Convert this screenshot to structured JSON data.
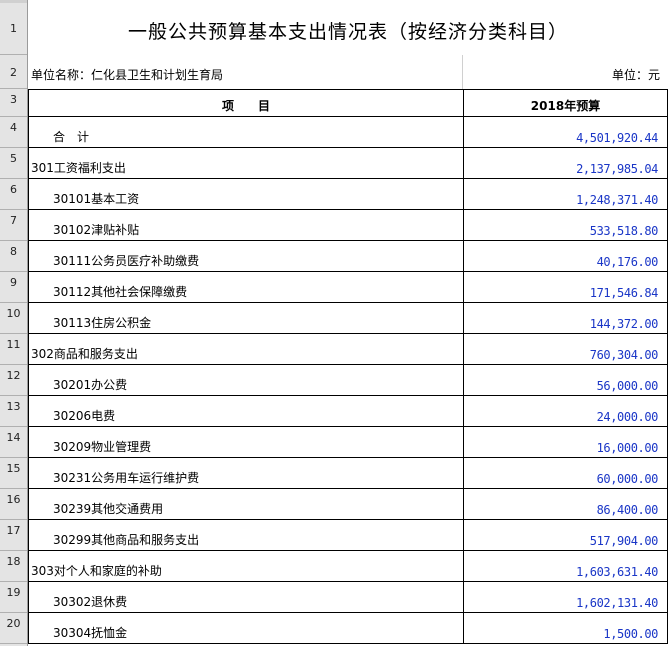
{
  "title": "一般公共预算基本支出情况表（按经济分类科目）",
  "unit_label": "单位名称：仁化县卫生和计划生育局",
  "unit": "单位：元",
  "row_headers": [
    "1",
    "2",
    "3",
    "4",
    "5",
    "6",
    "7",
    "8",
    "9",
    "10",
    "11",
    "12",
    "13",
    "14",
    "15",
    "16",
    "17",
    "18",
    "19",
    "20"
  ],
  "table": {
    "header_item": "项　　目",
    "header_budget": "2018年预算",
    "rows": [
      {
        "item": "合　计",
        "value": "4,501,920.44",
        "indent": 2
      },
      {
        "item": "301工资福利支出",
        "value": "2,137,985.04",
        "indent": 0
      },
      {
        "item": "30101基本工资",
        "value": "1,248,371.40",
        "indent": 1
      },
      {
        "item": "30102津贴补贴",
        "value": "533,518.80",
        "indent": 1
      },
      {
        "item": "30111公务员医疗补助缴费",
        "value": "40,176.00",
        "indent": 1
      },
      {
        "item": "30112其他社会保障缴费",
        "value": "171,546.84",
        "indent": 1
      },
      {
        "item": "30113住房公积金",
        "value": "144,372.00",
        "indent": 1
      },
      {
        "item": "302商品和服务支出",
        "value": "760,304.00",
        "indent": 0
      },
      {
        "item": "30201办公费",
        "value": "56,000.00",
        "indent": 1
      },
      {
        "item": "30206电费",
        "value": "24,000.00",
        "indent": 1
      },
      {
        "item": "30209物业管理费",
        "value": "16,000.00",
        "indent": 1
      },
      {
        "item": "30231公务用车运行维护费",
        "value": "60,000.00",
        "indent": 1
      },
      {
        "item": "30239其他交通费用",
        "value": "86,400.00",
        "indent": 1
      },
      {
        "item": "30299其他商品和服务支出",
        "value": "517,904.00",
        "indent": 1
      },
      {
        "item": "303对个人和家庭的补助",
        "value": "1,603,631.40",
        "indent": 0
      },
      {
        "item": "30302退休费",
        "value": "1,602,131.40",
        "indent": 1
      },
      {
        "item": "30304抚恤金",
        "value": "1,500.00",
        "indent": 1
      }
    ]
  }
}
